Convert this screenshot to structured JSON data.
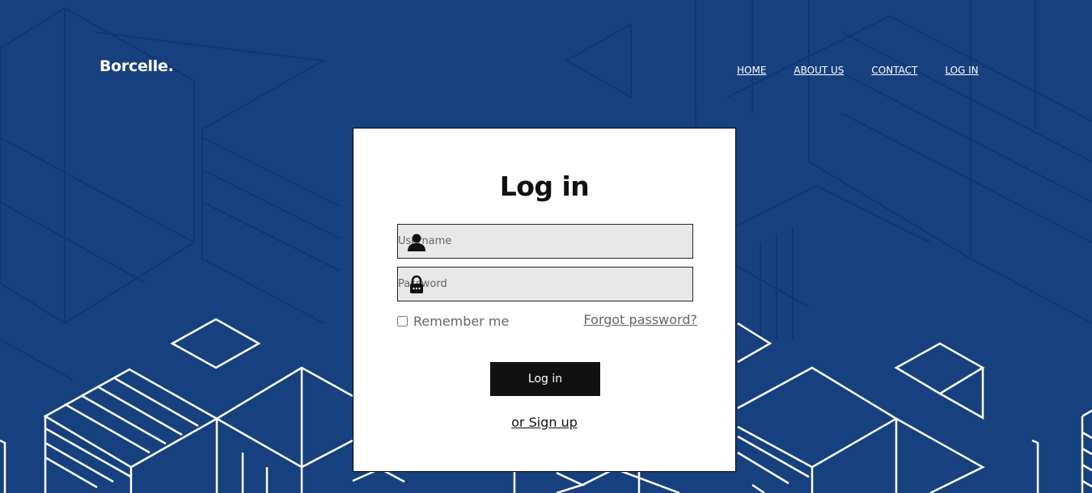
{
  "brand": {
    "name": "Borcelle."
  },
  "nav": {
    "items": [
      {
        "label": "HOME"
      },
      {
        "label": "ABOUT US"
      },
      {
        "label": "CONTACT"
      },
      {
        "label": "LOG IN"
      }
    ]
  },
  "login": {
    "title": "Log in",
    "username": {
      "placeholder": "Username",
      "icon": "user-icon"
    },
    "password": {
      "placeholder": "Password",
      "icon": "lock-icon"
    },
    "remember_label": "Remember me",
    "remember_checked": false,
    "forgot_label": "Forgot password?",
    "submit_label": "Log in",
    "signup_label": "or Sign up"
  },
  "colors": {
    "background": "#17407f",
    "card": "#ffffff",
    "button": "#111111",
    "field": "#e8e8e8"
  }
}
